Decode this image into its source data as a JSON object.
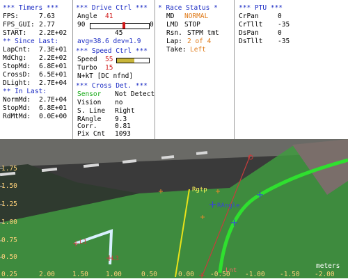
{
  "timers": {
    "header": "*** Timers ***",
    "fps_label": "FPS:",
    "fps": "7.63",
    "fps_gui_label": "FPS_GUI:",
    "fps_gui": "2.77",
    "start_label": "START:",
    "start": "2.2E+02",
    "since_last_header": "** Since Last:",
    "lapcnt_label": "LapCnt:",
    "lapcnt": "7.3E+01",
    "mdchg_label": "MdChg:",
    "mdchg": "2.2E+02",
    "stopmd_label": "StopMd:",
    "stopmd": "6.8E+01",
    "crossd_label": "CrossD:",
    "crossd": "6.5E+01",
    "dlight_label": "DLight:",
    "dlight": "2.7E+04",
    "in_last_header": "** In Last:",
    "normmd_label": "NormMd:",
    "normmd": "2.7E+04",
    "stopmd2_label": "StopMd:",
    "stopmd2": "6.8E+01",
    "rdmtmd_label": "RdMtMd:",
    "rdmtmd": "0.0E+00"
  },
  "drive": {
    "header": "*** Drive Ctrl ***",
    "angle_label": "Angle",
    "angle_value": "41",
    "gauge_min": "90",
    "gauge_max": "0",
    "gauge_fraction": 0.57,
    "center_value": "45",
    "avg_dev": "avg=38.6 dev=1.9",
    "speed_header": "*** Speed Ctrl ***",
    "speed_label": "Speed",
    "speed_value": "55",
    "speed_fraction": 0.55,
    "turbo_label": "Turbo",
    "turbo_value": "15",
    "nkt": "N+kT [DC nfnd]",
    "cross_header": "*** Cross Det. ***",
    "sensor_label": "Sensor",
    "sensor_value": "Not Detect.",
    "vision_label": "Vision",
    "vision_value": "no",
    "sline_label": "S. Line",
    "sline_value": "Right",
    "rangle_label": "RAngle",
    "rangle_value": "9.3",
    "corr_label": "Corr.",
    "corr_value": "0.81",
    "pixcnt_label": "Pix Cnt",
    "pixcnt_value": "1093"
  },
  "race": {
    "header": "* Race Status *",
    "md_label": "MD",
    "md_value": "NORMAL",
    "lmd_label": "LMD",
    "lmd_value": "STOP",
    "rsn_label": "Rsn.",
    "rsn_value": "STPM tmt",
    "lap_label": "Lap:",
    "lap_value": "2 of 4",
    "take_label": "Take:",
    "take_value": "Left"
  },
  "ptu": {
    "header": "*** PTU ***",
    "crpan_label": "CrPan",
    "crpan": "0",
    "crtilt_label": "CrTllt",
    "crtilt": "-35",
    "dspan_label": "DsPan",
    "dspan": "0",
    "dstilt_label": "DsTllt",
    "dstilt": "-35"
  },
  "camera": {
    "y_ticks": [
      "1.75",
      "1.50",
      "1.25",
      "1.00",
      "0.75",
      "0.50",
      "0.25"
    ],
    "x_ticks": [
      "2.00",
      "1.50",
      "1.00",
      "0.50",
      "0.00",
      "-0.50",
      "-1.00",
      "-1.50",
      "-2.00"
    ],
    "units": "meters",
    "labels": {
      "rgtp": "Rgtp",
      "rangle": "RAngle",
      "l1": "L1",
      "l3": "L3",
      "lnt": "Lnt"
    },
    "colors": {
      "green_region": "#3f9a3f",
      "track_line": "#2fe02f",
      "yellow_line": "#e8e21a",
      "red_line": "#c83c3c",
      "blue_marker": "#3a42d8"
    }
  }
}
